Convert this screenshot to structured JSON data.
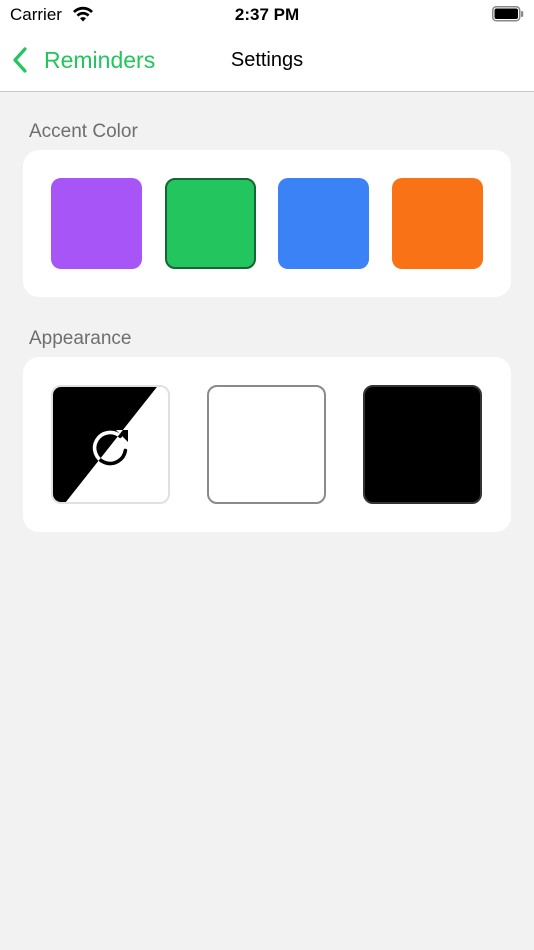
{
  "status_bar": {
    "carrier": "Carrier",
    "time": "2:37 PM",
    "wifi_icon": "wifi-icon",
    "battery_icon": "battery-icon"
  },
  "nav": {
    "back_label": "Reminders",
    "back_icon": "chevron-left-icon",
    "title": "Settings",
    "accent": "#22c55e"
  },
  "accent_section": {
    "label": "Accent Color",
    "selected": "green",
    "swatches": [
      {
        "name": "purple",
        "color": "#a855f7"
      },
      {
        "name": "green",
        "color": "#22c55e"
      },
      {
        "name": "blue",
        "color": "#3b82f6"
      },
      {
        "name": "orange",
        "color": "#f97316"
      }
    ]
  },
  "appearance_section": {
    "label": "Appearance",
    "options": [
      {
        "name": "automatic",
        "icon": "auto-rotate-icon"
      },
      {
        "name": "light",
        "color": "#ffffff"
      },
      {
        "name": "dark",
        "color": "#000000"
      }
    ]
  }
}
